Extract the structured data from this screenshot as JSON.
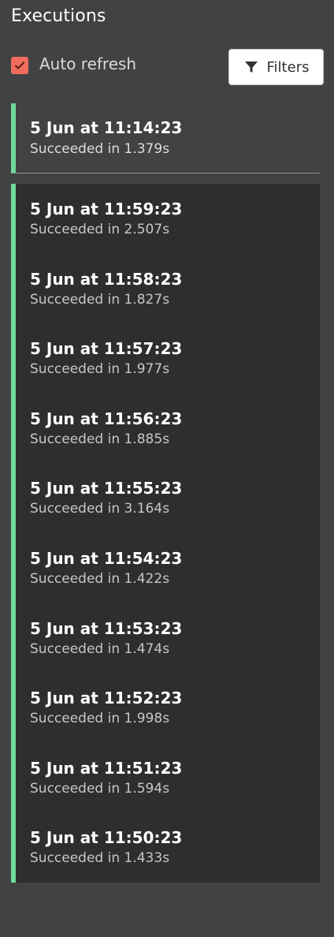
{
  "header": {
    "title": "Executions"
  },
  "controls": {
    "auto_refresh_label": "Auto refresh",
    "auto_refresh_checked": true,
    "filters_label": "Filters",
    "checkbox_color": "#f06c5d",
    "filters_icon": "filter-icon",
    "check_icon": "check-icon"
  },
  "colors": {
    "success_bar": "#6fd89b",
    "background": "#414243",
    "list_background": "#2d2e2e"
  },
  "pinned_execution": {
    "time": "5 Jun at 11:14:23",
    "status": "Succeeded in 1.379s"
  },
  "executions": [
    {
      "time": "5 Jun at 11:59:23",
      "status": "Succeeded in 2.507s"
    },
    {
      "time": "5 Jun at 11:58:23",
      "status": "Succeeded in 1.827s"
    },
    {
      "time": "5 Jun at 11:57:23",
      "status": "Succeeded in 1.977s"
    },
    {
      "time": "5 Jun at 11:56:23",
      "status": "Succeeded in 1.885s"
    },
    {
      "time": "5 Jun at 11:55:23",
      "status": "Succeeded in 3.164s"
    },
    {
      "time": "5 Jun at 11:54:23",
      "status": "Succeeded in 1.422s"
    },
    {
      "time": "5 Jun at 11:53:23",
      "status": "Succeeded in 1.474s"
    },
    {
      "time": "5 Jun at 11:52:23",
      "status": "Succeeded in 1.998s"
    },
    {
      "time": "5 Jun at 11:51:23",
      "status": "Succeeded in 1.594s"
    },
    {
      "time": "5 Jun at 11:50:23",
      "status": "Succeeded in 1.433s"
    }
  ]
}
